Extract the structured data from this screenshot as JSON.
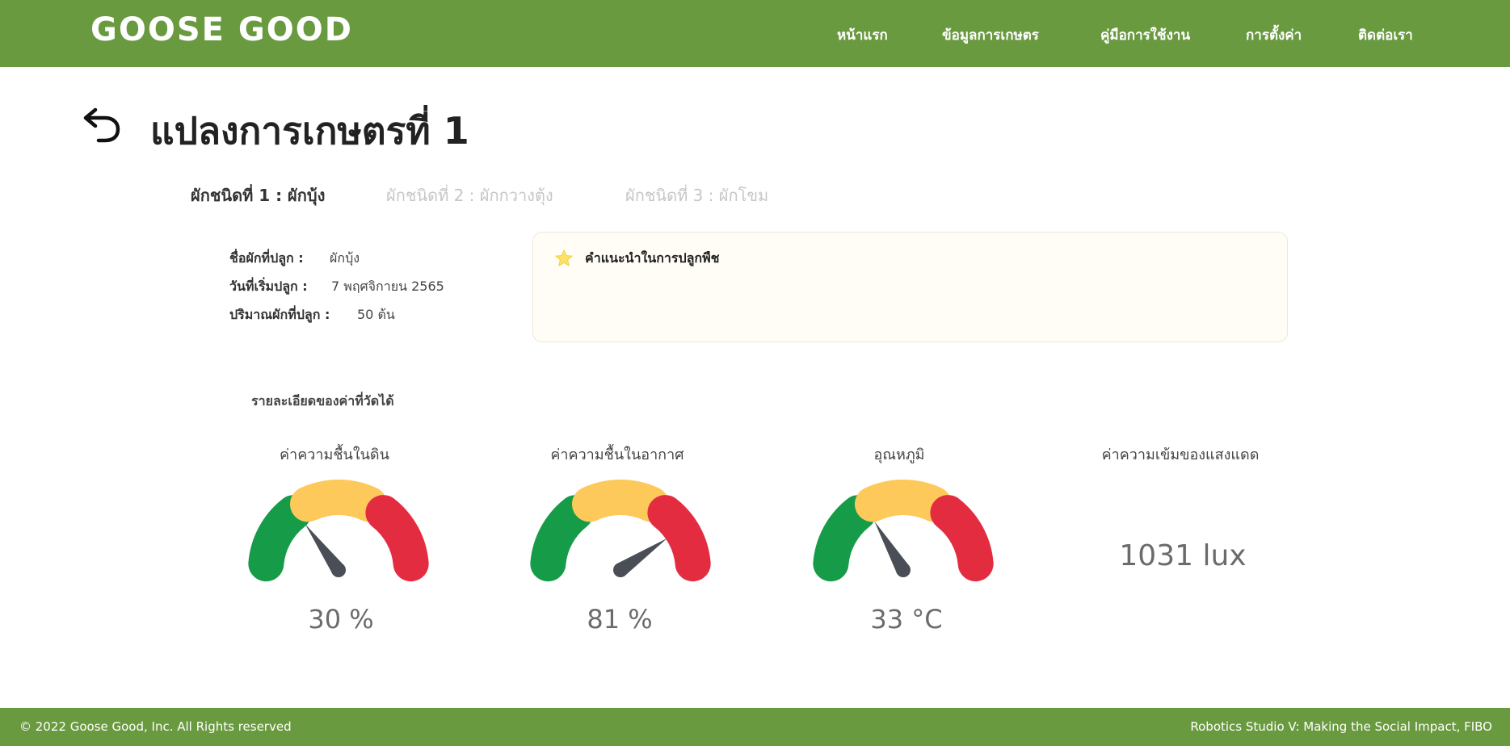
{
  "header": {
    "brand": "GOOSE GOOD",
    "nav": [
      "หน้าแรก",
      "ข้อมูลการเกษตร",
      "คู่มือการใช้งาน",
      "การตั้งค่า",
      "ติดต่อเรา"
    ]
  },
  "page": {
    "title": "แปลงการเกษตรที่ 1",
    "back_icon": "undo-arrow-icon"
  },
  "tabs": [
    {
      "label": "ผักชนิดที่ 1 : ผักบุ้ง",
      "active": true
    },
    {
      "label": "ผักชนิดที่ 2 : ผักกวางตุ้ง",
      "active": false
    },
    {
      "label": "ผักชนิดที่ 3 : ผักโขม",
      "active": false
    }
  ],
  "plant_info": {
    "name_label": "ชื่อผักที่ปลูก :",
    "name_value": "ผักบุ้ง",
    "date_label": "วันที่เริ่มปลูก :",
    "date_value": "7 พฤศจิกายน 2565",
    "qty_label": "ปริมาณผักที่ปลูก :",
    "qty_value": "50 ต้น"
  },
  "advice": {
    "icon": "star-icon",
    "title": "คำแนะนำในการปลูกพืช"
  },
  "measurements": {
    "title": "รายละเอียดของค่าที่วัดได้",
    "colors": {
      "low": "#169c48",
      "mid": "#fdc95a",
      "high": "#e42c41",
      "needle": "#4a4e56"
    },
    "soil_moisture": {
      "label": "ค่าความชื้นในดิน",
      "value": 30,
      "display": "30 %"
    },
    "air_humidity": {
      "label": "ค่าความชื้นในอากาศ",
      "value": 81,
      "display": "81 %"
    },
    "temperature": {
      "label": "อุณหภูมิ",
      "value": 33,
      "display": "33 °C"
    },
    "light": {
      "label": "ค่าความเข้มของแสงแดด",
      "display": "1031 lux"
    }
  },
  "footer": {
    "left": "© 2022 Goose Good, Inc. All Rights reserved",
    "right": "Robotics Studio V: Making the Social Impact, FIBO"
  },
  "theme": {
    "primary": "#6a9a40"
  }
}
